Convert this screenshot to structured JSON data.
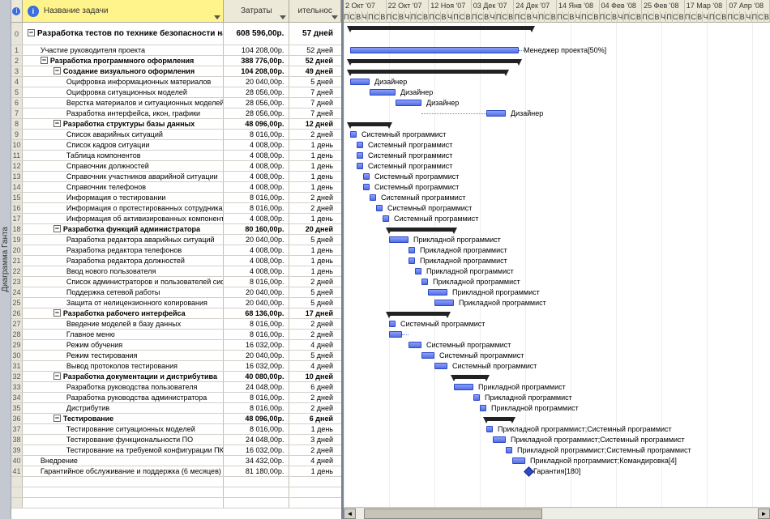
{
  "side_tab": "Диаграмма Ганта",
  "columns": {
    "task_name": "Название задачи",
    "cost": "Затраты",
    "duration": "ительнос"
  },
  "timescale_weeks": [
    "2 Окт '07",
    "22 Окт '07",
    "12 Ноя '07",
    "03 Дек '07",
    "24 Дек '07",
    "14 Янв '08",
    "04 Фев '08",
    "25 Фев '08",
    "17 Мар '08",
    "07 Апр '08"
  ],
  "timescale_days": [
    "Ч",
    "Ч",
    "П",
    "П",
    "С",
    "Ч",
    "П",
    "В",
    "С",
    "П"
  ],
  "bar_color": "#5570e0",
  "summary_color": "#111",
  "chart_data": {
    "type": "bar",
    "note": "Gantt tasks; start/len in time-units (3-day ticks). Summary rows have bar_type=summary.",
    "xlim": [
      0,
      66
    ]
  },
  "tasks": [
    {
      "id": 0,
      "level": 0,
      "summary": true,
      "name": "Разработка тестов по технике безопасности на заводе",
      "cost": "608 596,00р.",
      "dur": "57 дней",
      "start": 1,
      "len": 28,
      "label": ""
    },
    {
      "id": 1,
      "level": 1,
      "summary": false,
      "name": "Участие руководителя проекта",
      "cost": "104 208,00р.",
      "dur": "52 дней",
      "start": 1,
      "len": 26,
      "label": "Менеджер проекта[50%]",
      "dashEnd": 28
    },
    {
      "id": 2,
      "level": 1,
      "summary": true,
      "name": "Разработка программного оформления",
      "cost": "388 776,00р.",
      "dur": "52 дней",
      "start": 1,
      "len": 26,
      "label": ""
    },
    {
      "id": 3,
      "level": 2,
      "summary": true,
      "name": "Создание визуального оформления",
      "cost": "104 208,00р.",
      "dur": "49 дней",
      "start": 1,
      "len": 24,
      "label": ""
    },
    {
      "id": 4,
      "level": 3,
      "summary": false,
      "name": "Оцифровка информационных материалов",
      "cost": "20 040,00р.",
      "dur": "5 дней",
      "start": 1,
      "len": 3,
      "label": "Дизайнер"
    },
    {
      "id": 5,
      "level": 3,
      "summary": false,
      "name": "Оцифровка ситуационных моделей",
      "cost": "28 056,00р.",
      "dur": "7 дней",
      "start": 4,
      "len": 4,
      "label": "Дизайнер"
    },
    {
      "id": 6,
      "level": 3,
      "summary": false,
      "name": "Верстка материалов и ситуационных моделей",
      "cost": "28 056,00р.",
      "dur": "7 дней",
      "start": 8,
      "len": 4,
      "label": "Дизайнер"
    },
    {
      "id": 7,
      "level": 3,
      "summary": false,
      "name": "Разработка интерфейса, икон, графики",
      "cost": "28 056,00р.",
      "dur": "7 дней",
      "start": 22,
      "len": 3,
      "label": "Дизайнер",
      "dashStart": 12
    },
    {
      "id": 8,
      "level": 2,
      "summary": true,
      "name": "Разработка структуры базы данных",
      "cost": "48 096,00р.",
      "dur": "12 дней",
      "start": 1,
      "len": 6,
      "label": ""
    },
    {
      "id": 9,
      "level": 3,
      "summary": false,
      "name": "Список аварийных ситуаций",
      "cost": "8 016,00р.",
      "dur": "2 дней",
      "start": 1,
      "len": 1,
      "label": "Системный программист"
    },
    {
      "id": 10,
      "level": 3,
      "summary": false,
      "name": "Список кадров ситуации",
      "cost": "4 008,00р.",
      "dur": "1 день",
      "start": 2,
      "len": 1,
      "label": "Системный программист"
    },
    {
      "id": 11,
      "level": 3,
      "summary": false,
      "name": "Таблица компонентов",
      "cost": "4 008,00р.",
      "dur": "1 день",
      "start": 2,
      "len": 1,
      "label": "Системный программист"
    },
    {
      "id": 12,
      "level": 3,
      "summary": false,
      "name": "Справочник должностей",
      "cost": "4 008,00р.",
      "dur": "1 день",
      "start": 2,
      "len": 1,
      "label": "Системный программист"
    },
    {
      "id": 13,
      "level": 3,
      "summary": false,
      "name": "Справочник участников аварийной ситуации",
      "cost": "4 008,00р.",
      "dur": "1 день",
      "start": 3,
      "len": 1,
      "label": "Системный программист"
    },
    {
      "id": 14,
      "level": 3,
      "summary": false,
      "name": "Справочник телефонов",
      "cost": "4 008,00р.",
      "dur": "1 день",
      "start": 3,
      "len": 1,
      "label": "Системный программист"
    },
    {
      "id": 15,
      "level": 3,
      "summary": false,
      "name": "Информация о тестировании",
      "cost": "8 016,00р.",
      "dur": "2 дней",
      "start": 4,
      "len": 1,
      "label": "Системный программист"
    },
    {
      "id": 16,
      "level": 3,
      "summary": false,
      "name": "Информация о протестированных сотрудниках",
      "cost": "8 016,00р.",
      "dur": "2 дней",
      "start": 5,
      "len": 1,
      "label": "Системный программист"
    },
    {
      "id": 17,
      "level": 3,
      "summary": false,
      "name": "Информация об активизированных компонентах",
      "cost": "4 008,00р.",
      "dur": "1 день",
      "start": 6,
      "len": 1,
      "label": "Системный программист"
    },
    {
      "id": 18,
      "level": 2,
      "summary": true,
      "name": "Разработка функций администратора",
      "cost": "80 160,00р.",
      "dur": "20 дней",
      "start": 7,
      "len": 10,
      "label": ""
    },
    {
      "id": 19,
      "level": 3,
      "summary": false,
      "name": "Разработка редактора аварийных ситуаций",
      "cost": "20 040,00р.",
      "dur": "5 дней",
      "start": 7,
      "len": 3,
      "label": "Прикладной программист"
    },
    {
      "id": 20,
      "level": 3,
      "summary": false,
      "name": "Разработка редактора телефонов",
      "cost": "4 008,00р.",
      "dur": "1 день",
      "start": 10,
      "len": 1,
      "label": "Прикладной программист"
    },
    {
      "id": 21,
      "level": 3,
      "summary": false,
      "name": "Разработка редактора должностей",
      "cost": "4 008,00р.",
      "dur": "1 день",
      "start": 10,
      "len": 1,
      "label": "Прикладной программист"
    },
    {
      "id": 22,
      "level": 3,
      "summary": false,
      "name": "Ввод нового пользователя",
      "cost": "4 008,00р.",
      "dur": "1 день",
      "start": 11,
      "len": 1,
      "label": "Прикладной программист"
    },
    {
      "id": 23,
      "level": 3,
      "summary": false,
      "name": "Список администраторов и пользователей системы",
      "cost": "8 016,00р.",
      "dur": "2 дней",
      "start": 12,
      "len": 1,
      "label": "Прикладной программист"
    },
    {
      "id": 24,
      "level": 3,
      "summary": false,
      "name": "Поддержка сетевой работы",
      "cost": "20 040,00р.",
      "dur": "5 дней",
      "start": 13,
      "len": 3,
      "label": "Прикладной программист"
    },
    {
      "id": 25,
      "level": 3,
      "summary": false,
      "name": "Защита от нелицензионного копирования",
      "cost": "20 040,00р.",
      "dur": "5 дней",
      "start": 14,
      "len": 3,
      "label": "Прикладной программист"
    },
    {
      "id": 26,
      "level": 2,
      "summary": true,
      "name": "Разработка рабочего интерфейса",
      "cost": "68 136,00р.",
      "dur": "17 дней",
      "start": 7,
      "len": 9,
      "label": ""
    },
    {
      "id": 27,
      "level": 3,
      "summary": false,
      "name": "Введение моделей в базу данных",
      "cost": "8 016,00р.",
      "dur": "2 дней",
      "start": 7,
      "len": 1,
      "label": "Системный программист"
    },
    {
      "id": 28,
      "level": 3,
      "summary": false,
      "name": "Главное меню",
      "cost": "8 016,00р.",
      "dur": "2 дней",
      "start": 7,
      "len": 2,
      "label": "",
      "dashEnd": 10
    },
    {
      "id": 29,
      "level": 3,
      "summary": false,
      "name": "Режим обучения",
      "cost": "16 032,00р.",
      "dur": "4 дней",
      "start": 10,
      "len": 2,
      "label": "Системный программист"
    },
    {
      "id": 30,
      "level": 3,
      "summary": false,
      "name": "Режим тестирования",
      "cost": "20 040,00р.",
      "dur": "5 дней",
      "start": 12,
      "len": 2,
      "label": "Системный программист"
    },
    {
      "id": 31,
      "level": 3,
      "summary": false,
      "name": "Вывод протоколов тестирования",
      "cost": "16 032,00р.",
      "dur": "4 дней",
      "start": 14,
      "len": 2,
      "label": "Системный программист"
    },
    {
      "id": 32,
      "level": 2,
      "summary": true,
      "name": "Разработка документации и дистрибутива",
      "cost": "40 080,00р.",
      "dur": "10 дней",
      "start": 17,
      "len": 5,
      "label": ""
    },
    {
      "id": 33,
      "level": 3,
      "summary": false,
      "name": "Разработка руководства пользователя",
      "cost": "24 048,00р.",
      "dur": "6 дней",
      "start": 17,
      "len": 3,
      "label": "Прикладной программист"
    },
    {
      "id": 34,
      "level": 3,
      "summary": false,
      "name": "Разработка руководства администратора",
      "cost": "8 016,00р.",
      "dur": "2 дней",
      "start": 20,
      "len": 1,
      "label": "Прикладной программист"
    },
    {
      "id": 35,
      "level": 3,
      "summary": false,
      "name": "Дистрибутив",
      "cost": "8 016,00р.",
      "dur": "2 дней",
      "start": 21,
      "len": 1,
      "label": "Прикладной программист"
    },
    {
      "id": 36,
      "level": 2,
      "summary": true,
      "name": "Тестирование",
      "cost": "48 096,00р.",
      "dur": "6 дней",
      "start": 22,
      "len": 4,
      "label": ""
    },
    {
      "id": 37,
      "level": 3,
      "summary": false,
      "name": "Тестирование ситуационных моделей",
      "cost": "8 016,00р.",
      "dur": "1 день",
      "start": 22,
      "len": 1,
      "label": "Прикладной программист;Системный программист"
    },
    {
      "id": 38,
      "level": 3,
      "summary": false,
      "name": "Тестирование функциональности ПО",
      "cost": "24 048,00р.",
      "dur": "3 дней",
      "start": 23,
      "len": 2,
      "label": "Прикладной программист;Системный программист"
    },
    {
      "id": 39,
      "level": 3,
      "summary": false,
      "name": "Тестирование на требуемой конфигурации ПК",
      "cost": "16 032,00р.",
      "dur": "2 дней",
      "start": 25,
      "len": 1,
      "label": "Прикладной программист;Системный программист"
    },
    {
      "id": 40,
      "level": 1,
      "summary": false,
      "name": "Внедрение",
      "cost": "34 432,00р.",
      "dur": "4 дней",
      "start": 26,
      "len": 2,
      "label": "Прикладной программист;Командировка[4]"
    },
    {
      "id": 41,
      "level": 1,
      "summary": false,
      "name": "Гарантийное обслуживание и поддержка (6 месяцев)",
      "cost": "81 180,00р.",
      "dur": "1 день",
      "start": 28,
      "len": 0,
      "label": "Гарантия[180]",
      "milestone": true
    }
  ]
}
